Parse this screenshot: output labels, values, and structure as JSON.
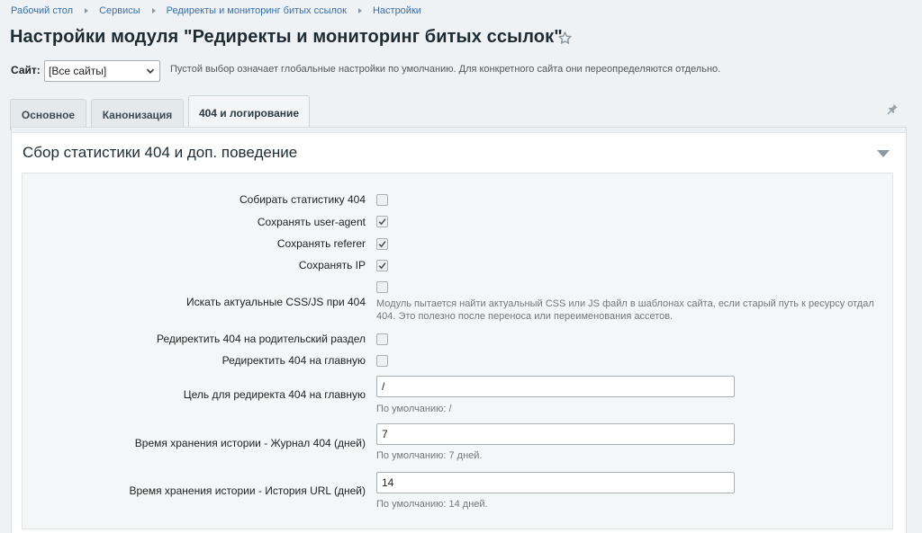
{
  "breadcrumb": [
    "Рабочий стол",
    "Сервисы",
    "Редиректы и мониторинг битых ссылок",
    "Настройки"
  ],
  "title": "Настройки модуля \"Редиректы и мониторинг битых ссылок\"",
  "site": {
    "label": "Сайт:",
    "selected": "[Все сайты]",
    "hint": "Пустой выбор означает глобальные настройки по умолчанию. Для конкретного сайта они переопределяются отдельно."
  },
  "tabs": [
    "Основное",
    "Канонизация",
    "404 и логирование"
  ],
  "active_tab": "404 и логирование",
  "section": {
    "title": "Сбор статистики 404 и доп. поведение",
    "fields": {
      "collect_stats": {
        "label": "Собирать статистику 404",
        "checked": false
      },
      "save_user_agent": {
        "label": "Сохранять user-agent",
        "checked": true
      },
      "save_referer": {
        "label": "Сохранять referer",
        "checked": true
      },
      "save_ip": {
        "label": "Сохранять IP",
        "checked": true
      },
      "find_css_js": {
        "label": "Искать актуальные CSS/JS при 404",
        "checked": false,
        "note": "Модуль пытается найти актуальный CSS или JS файл в шаблонах сайта, если старый путь к ресурсу отдал 404. Это полезно после переноса или переименования ассетов."
      },
      "redirect_parent": {
        "label": "Редиректить 404 на родительский раздел",
        "checked": false
      },
      "redirect_home": {
        "label": "Редиректить 404 на главную",
        "checked": false
      },
      "redirect_target": {
        "label": "Цель для редиректа 404 на главную",
        "value": "/",
        "hint": "По умолчанию: /"
      },
      "journal_retention": {
        "label": "Время хранения истории - Журнал 404 (дней)",
        "value": "7",
        "hint": "По умолчанию: 7 дней."
      },
      "url_history_retention": {
        "label": "Время хранения истории - История URL (дней)",
        "value": "14",
        "hint": "По умолчанию: 14 дней."
      }
    }
  },
  "icons": {
    "favorite": "star-icon",
    "pin": "pin-icon",
    "collapse": "collapse-triangle-icon",
    "select": "chevron-down-icon",
    "check": "check-icon"
  },
  "colors": {
    "link": "#3b6ea5",
    "background": "#eef2f4",
    "panel": "#ffffff",
    "inner": "#f5f6f7"
  }
}
